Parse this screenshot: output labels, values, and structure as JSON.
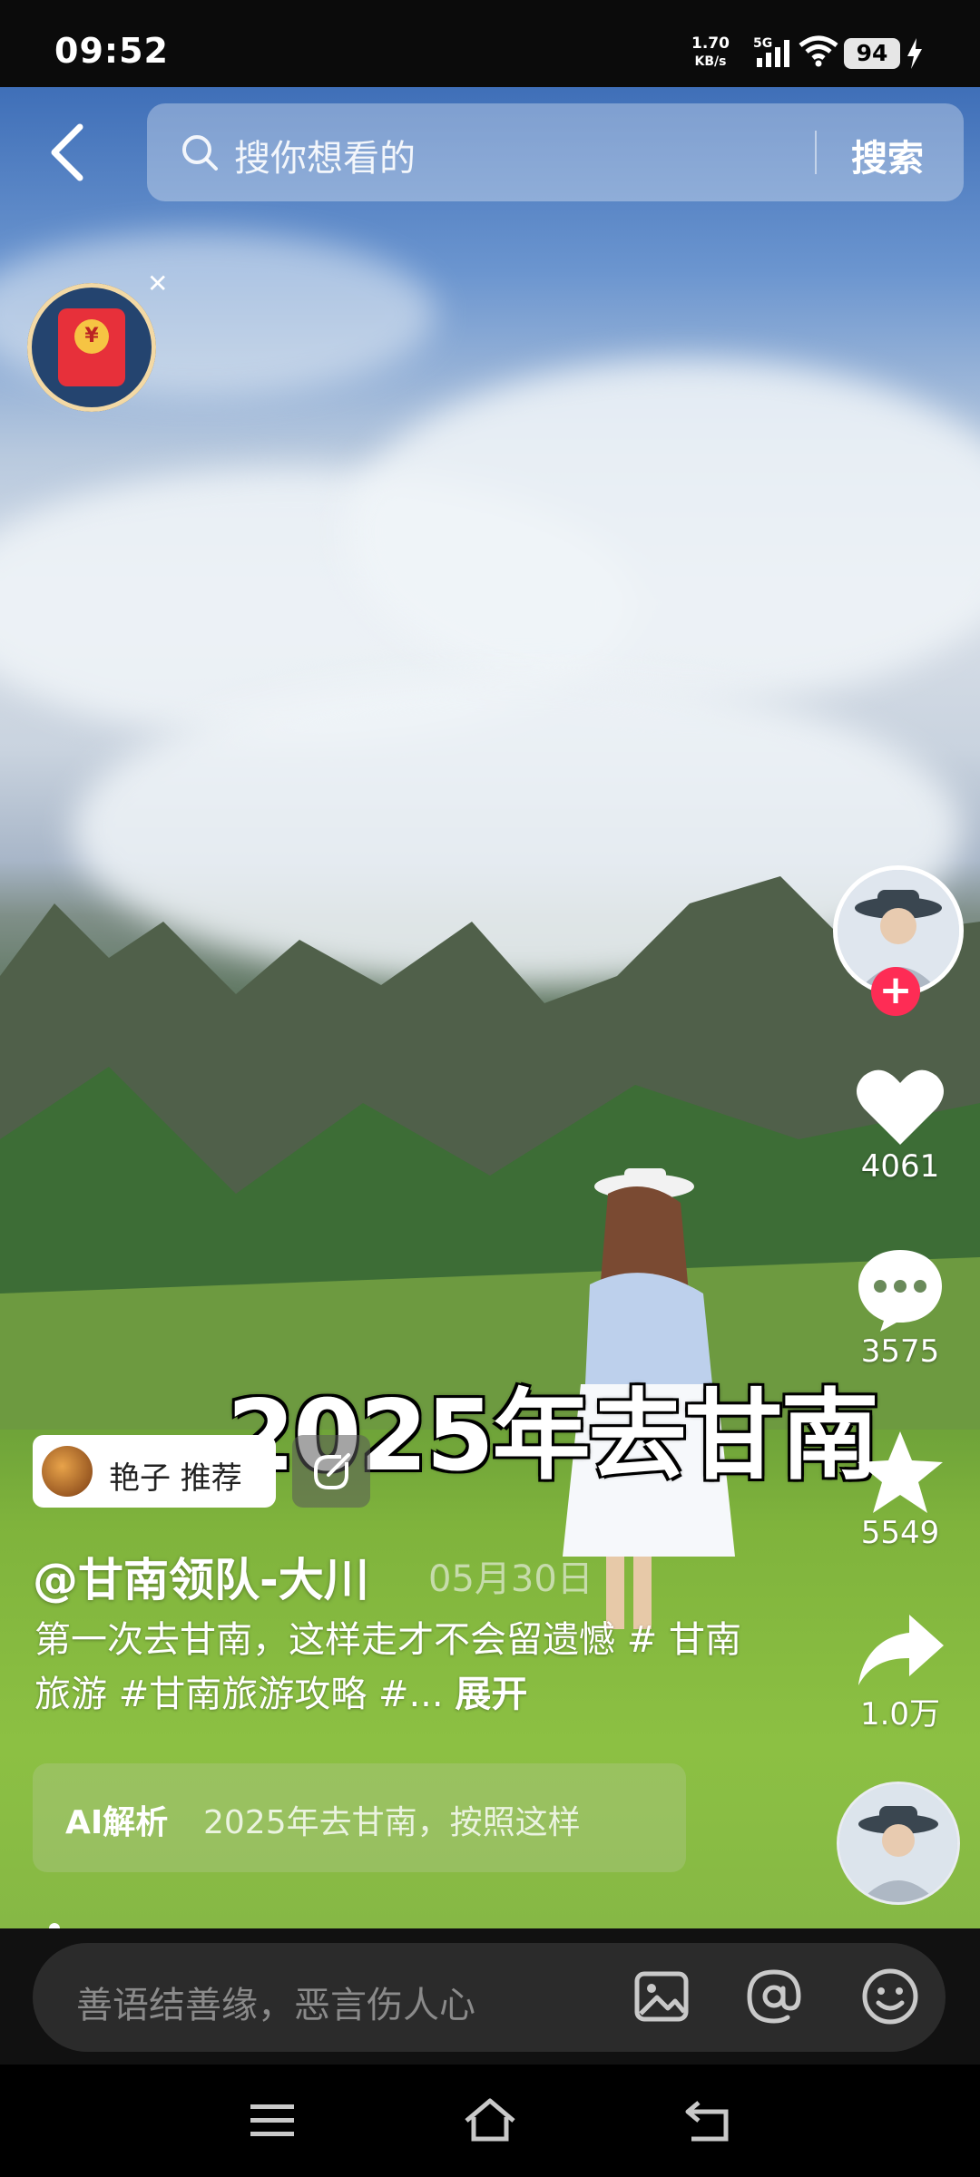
{
  "status_bar": {
    "time": "09:52",
    "net_speed": "1.70",
    "net_unit": "KB/s",
    "network": "5G",
    "battery": "94"
  },
  "search": {
    "placeholder": "搜你想看的",
    "button": "搜索"
  },
  "video": {
    "overlay_title": "2025年去甘南"
  },
  "actions": {
    "likes": "4061",
    "comments": "3575",
    "favorites": "5549",
    "shares": "1.0万"
  },
  "post": {
    "recommender": "艳子 推荐",
    "author": "@甘南领队-大川",
    "date": "05月30日",
    "description": "第一次去甘南，这样走才不会留遗憾 # 甘南旅游 #甘南旅游攻略 #...",
    "expand": "展开",
    "ai_label": "AI解析",
    "ai_text": "2025年去甘南，按照这样"
  },
  "comment": {
    "placeholder": "善语结善缘，恶言伤人心"
  },
  "icons": [
    "back-icon",
    "search-icon",
    "red-packet-icon",
    "close-icon",
    "heart-icon",
    "comment-icon",
    "star-icon",
    "share-icon",
    "image-icon",
    "at-icon",
    "emoji-icon",
    "menu-icon",
    "home-icon",
    "back-nav-icon"
  ]
}
